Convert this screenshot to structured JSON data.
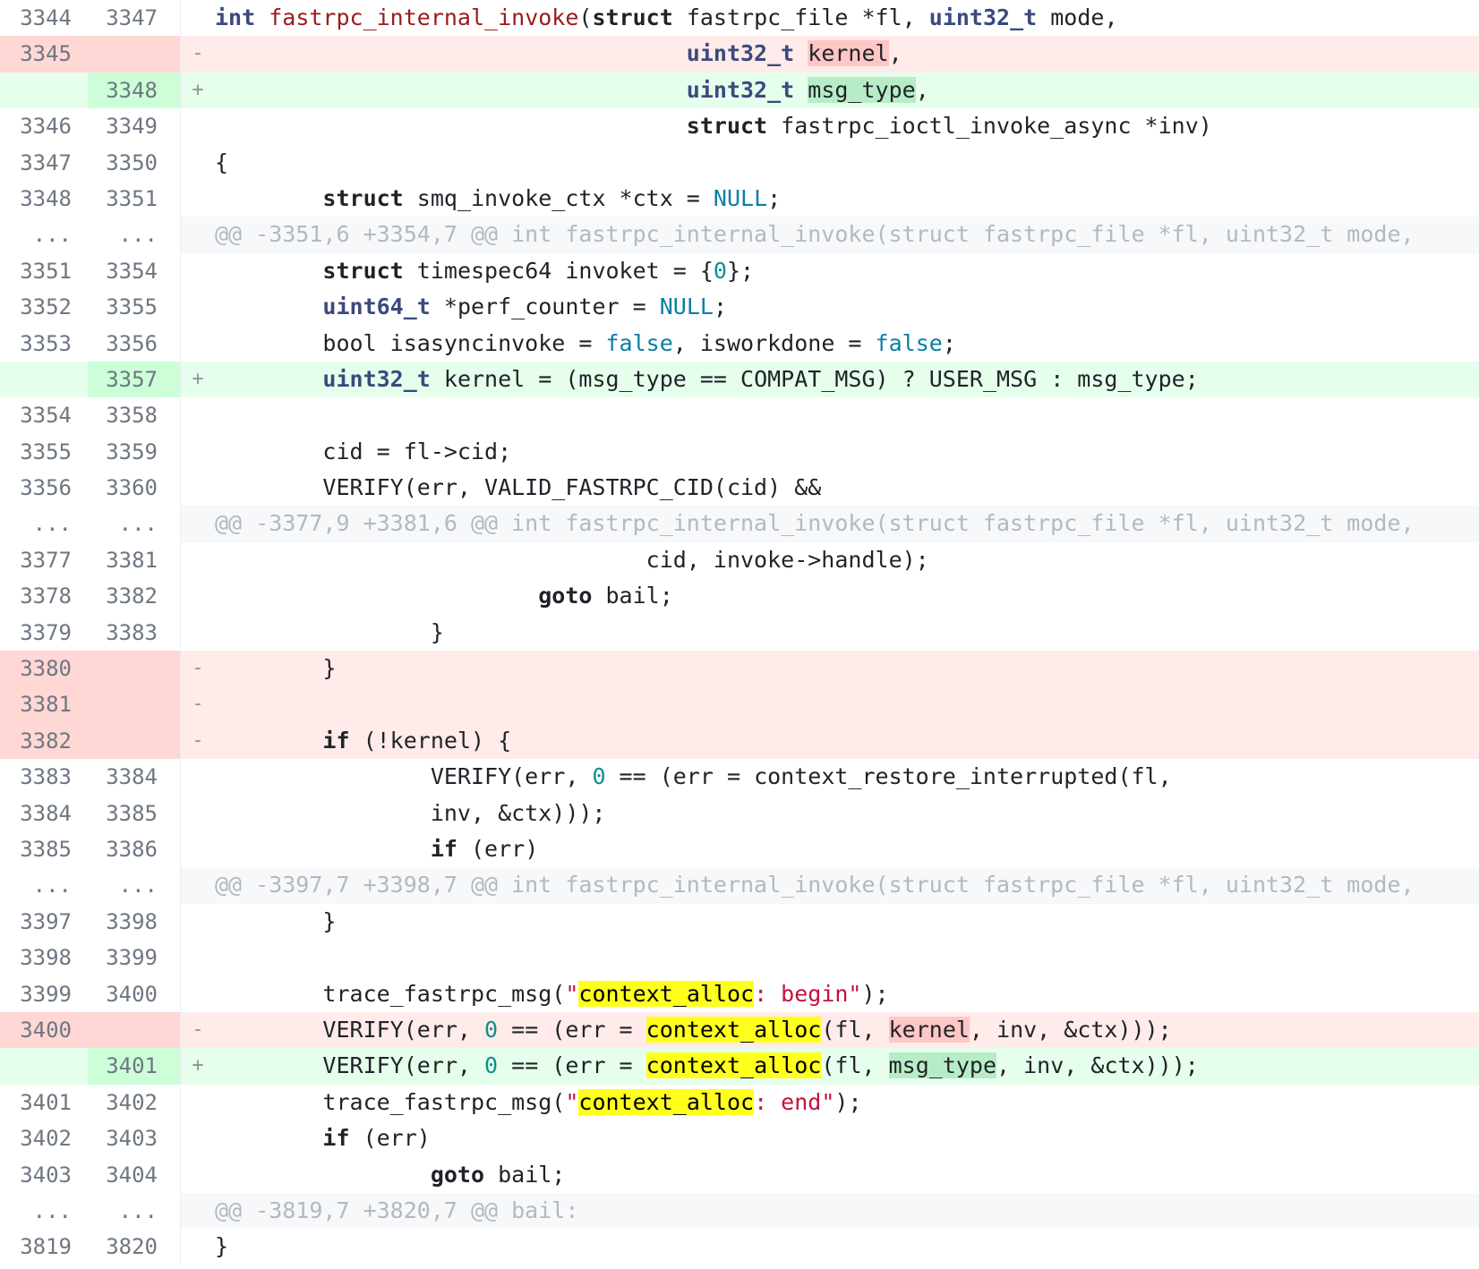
{
  "diff": {
    "rows": [
      {
        "type": "ctx",
        "old": "3344",
        "new": "3347",
        "marker": "",
        "code": [
          [
            "ty",
            "int"
          ],
          [
            "t",
            " "
          ],
          [
            "fn",
            "fastrpc_internal_invoke"
          ],
          [
            "t",
            "("
          ],
          [
            "kw",
            "struct"
          ],
          [
            "t",
            " fastrpc_file *fl, "
          ],
          [
            "ty",
            "uint32_t"
          ],
          [
            "t",
            " mode,"
          ]
        ]
      },
      {
        "type": "del",
        "old": "3345",
        "new": "",
        "marker": "-",
        "code": [
          [
            "t",
            "                                   "
          ],
          [
            "ty",
            "uint32_t"
          ],
          [
            "t",
            " "
          ],
          [
            "hl-del",
            "kernel"
          ],
          [
            "t",
            ","
          ]
        ]
      },
      {
        "type": "add",
        "old": "",
        "new": "3348",
        "marker": "+",
        "code": [
          [
            "t",
            "                                   "
          ],
          [
            "ty",
            "uint32_t"
          ],
          [
            "t",
            " "
          ],
          [
            "hl-add",
            "msg_type"
          ],
          [
            "t",
            ","
          ]
        ]
      },
      {
        "type": "ctx",
        "old": "3346",
        "new": "3349",
        "marker": "",
        "code": [
          [
            "t",
            "                                   "
          ],
          [
            "kw",
            "struct"
          ],
          [
            "t",
            " fastrpc_ioctl_invoke_async *inv)"
          ]
        ]
      },
      {
        "type": "ctx",
        "old": "3347",
        "new": "3350",
        "marker": "",
        "code": [
          [
            "t",
            "{"
          ]
        ]
      },
      {
        "type": "ctx",
        "old": "3348",
        "new": "3351",
        "marker": "",
        "code": [
          [
            "t",
            "        "
          ],
          [
            "kw",
            "struct"
          ],
          [
            "t",
            " smq_invoke_ctx *ctx = "
          ],
          [
            "nu",
            "NULL"
          ],
          [
            "t",
            ";"
          ]
        ]
      },
      {
        "type": "hunk",
        "old": "...",
        "new": "...",
        "marker": "",
        "code": [
          [
            "t",
            "@@ -3351,6 +3354,7 @@ int fastrpc_internal_invoke(struct fastrpc_file *fl, uint32_t mode,"
          ]
        ]
      },
      {
        "type": "ctx",
        "old": "3351",
        "new": "3354",
        "marker": "",
        "code": [
          [
            "t",
            "        "
          ],
          [
            "kw",
            "struct"
          ],
          [
            "t",
            " timespec64 invoket = {"
          ],
          [
            "num",
            "0"
          ],
          [
            "t",
            "};"
          ]
        ]
      },
      {
        "type": "ctx",
        "old": "3352",
        "new": "3355",
        "marker": "",
        "code": [
          [
            "t",
            "        "
          ],
          [
            "ty",
            "uint64_t"
          ],
          [
            "t",
            " *perf_counter = "
          ],
          [
            "nu",
            "NULL"
          ],
          [
            "t",
            ";"
          ]
        ]
      },
      {
        "type": "ctx",
        "old": "3353",
        "new": "3356",
        "marker": "",
        "code": [
          [
            "t",
            "        bool isasyncinvoke = "
          ],
          [
            "nu",
            "false"
          ],
          [
            "t",
            ", isworkdone = "
          ],
          [
            "nu",
            "false"
          ],
          [
            "t",
            ";"
          ]
        ]
      },
      {
        "type": "add",
        "old": "",
        "new": "3357",
        "marker": "+",
        "code": [
          [
            "t",
            "        "
          ],
          [
            "ty",
            "uint32_t"
          ],
          [
            "t",
            " kernel = (msg_type == COMPAT_MSG) ? USER_MSG : msg_type;"
          ]
        ]
      },
      {
        "type": "ctx",
        "old": "3354",
        "new": "3358",
        "marker": "",
        "code": []
      },
      {
        "type": "ctx",
        "old": "3355",
        "new": "3359",
        "marker": "",
        "code": [
          [
            "t",
            "        cid = fl->cid;"
          ]
        ]
      },
      {
        "type": "ctx",
        "old": "3356",
        "new": "3360",
        "marker": "",
        "code": [
          [
            "t",
            "        VERIFY(err, VALID_FASTRPC_CID(cid) &&"
          ]
        ]
      },
      {
        "type": "hunk",
        "old": "...",
        "new": "...",
        "marker": "",
        "code": [
          [
            "t",
            "@@ -3377,9 +3381,6 @@ int fastrpc_internal_invoke(struct fastrpc_file *fl, uint32_t mode,"
          ]
        ]
      },
      {
        "type": "ctx",
        "old": "3377",
        "new": "3381",
        "marker": "",
        "code": [
          [
            "t",
            "                                cid, invoke->handle);"
          ]
        ]
      },
      {
        "type": "ctx",
        "old": "3378",
        "new": "3382",
        "marker": "",
        "code": [
          [
            "t",
            "                        "
          ],
          [
            "kw",
            "goto"
          ],
          [
            "t",
            " bail;"
          ]
        ]
      },
      {
        "type": "ctx",
        "old": "3379",
        "new": "3383",
        "marker": "",
        "code": [
          [
            "t",
            "                }"
          ]
        ]
      },
      {
        "type": "del",
        "old": "3380",
        "new": "",
        "marker": "-",
        "code": [
          [
            "t",
            "        }"
          ]
        ]
      },
      {
        "type": "del",
        "old": "3381",
        "new": "",
        "marker": "-",
        "code": []
      },
      {
        "type": "del",
        "old": "3382",
        "new": "",
        "marker": "-",
        "code": [
          [
            "t",
            "        "
          ],
          [
            "kw",
            "if"
          ],
          [
            "t",
            " (!kernel) {"
          ]
        ]
      },
      {
        "type": "ctx",
        "old": "3383",
        "new": "3384",
        "marker": "",
        "code": [
          [
            "t",
            "                VERIFY(err, "
          ],
          [
            "num",
            "0"
          ],
          [
            "t",
            " == (err = context_restore_interrupted(fl,"
          ]
        ]
      },
      {
        "type": "ctx",
        "old": "3384",
        "new": "3385",
        "marker": "",
        "code": [
          [
            "t",
            "                inv, &ctx)));"
          ]
        ]
      },
      {
        "type": "ctx",
        "old": "3385",
        "new": "3386",
        "marker": "",
        "code": [
          [
            "t",
            "                "
          ],
          [
            "kw",
            "if"
          ],
          [
            "t",
            " (err)"
          ]
        ]
      },
      {
        "type": "hunk",
        "old": "...",
        "new": "...",
        "marker": "",
        "code": [
          [
            "t",
            "@@ -3397,7 +3398,7 @@ int fastrpc_internal_invoke(struct fastrpc_file *fl, uint32_t mode,"
          ]
        ]
      },
      {
        "type": "ctx",
        "old": "3397",
        "new": "3398",
        "marker": "",
        "code": [
          [
            "t",
            "        }"
          ]
        ]
      },
      {
        "type": "ctx",
        "old": "3398",
        "new": "3399",
        "marker": "",
        "code": []
      },
      {
        "type": "ctx",
        "old": "3399",
        "new": "3400",
        "marker": "",
        "code": [
          [
            "t",
            "        trace_fastrpc_msg("
          ],
          [
            "str",
            "\""
          ],
          [
            "hl",
            "context_alloc"
          ],
          [
            "str",
            ": begin\""
          ],
          [
            "t",
            ");"
          ]
        ]
      },
      {
        "type": "del",
        "old": "3400",
        "new": "",
        "marker": "-",
        "code": [
          [
            "t",
            "        VERIFY(err, "
          ],
          [
            "num",
            "0"
          ],
          [
            "t",
            " == (err = "
          ],
          [
            "hl",
            "context_alloc"
          ],
          [
            "t",
            "(fl, "
          ],
          [
            "hl-del",
            "kernel"
          ],
          [
            "t",
            ", inv, &ctx)));"
          ]
        ]
      },
      {
        "type": "add",
        "old": "",
        "new": "3401",
        "marker": "+",
        "code": [
          [
            "t",
            "        VERIFY(err, "
          ],
          [
            "num",
            "0"
          ],
          [
            "t",
            " == (err = "
          ],
          [
            "hl",
            "context_alloc"
          ],
          [
            "t",
            "(fl, "
          ],
          [
            "hl-add",
            "msg_type"
          ],
          [
            "t",
            ", inv, &ctx)));"
          ]
        ]
      },
      {
        "type": "ctx",
        "old": "3401",
        "new": "3402",
        "marker": "",
        "code": [
          [
            "t",
            "        trace_fastrpc_msg("
          ],
          [
            "str",
            "\""
          ],
          [
            "hl",
            "context_alloc"
          ],
          [
            "str",
            ": end\""
          ],
          [
            "t",
            ");"
          ]
        ]
      },
      {
        "type": "ctx",
        "old": "3402",
        "new": "3403",
        "marker": "",
        "code": [
          [
            "t",
            "        "
          ],
          [
            "kw",
            "if"
          ],
          [
            "t",
            " (err)"
          ]
        ]
      },
      {
        "type": "ctx",
        "old": "3403",
        "new": "3404",
        "marker": "",
        "code": [
          [
            "t",
            "                "
          ],
          [
            "kw",
            "goto"
          ],
          [
            "t",
            " bail;"
          ]
        ]
      },
      {
        "type": "hunk",
        "old": "...",
        "new": "...",
        "marker": "",
        "code": [
          [
            "t",
            "@@ -3819,7 +3820,7 @@ bail:"
          ]
        ]
      },
      {
        "type": "ctx",
        "old": "3819",
        "new": "3820",
        "marker": "",
        "code": [
          [
            "t",
            "}"
          ]
        ]
      }
    ]
  }
}
